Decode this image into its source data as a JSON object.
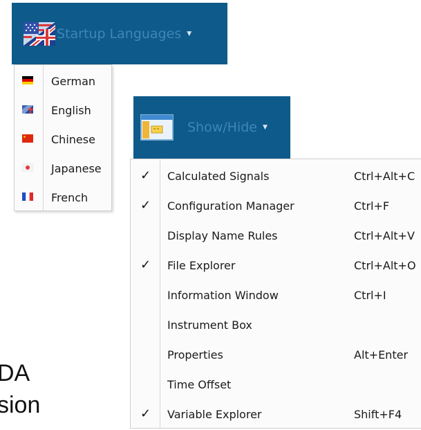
{
  "background": {
    "line1": "DA",
    "line2": "sion"
  },
  "startup_languages": {
    "label": "Startup Languages",
    "items": [
      {
        "label": "German",
        "icon": "flag-germany-icon"
      },
      {
        "label": "English",
        "icon": "flag-uk-icon"
      },
      {
        "label": "Chinese",
        "icon": "flag-china-icon"
      },
      {
        "label": "Japanese",
        "icon": "flag-japan-icon"
      },
      {
        "label": "French",
        "icon": "flag-france-icon"
      }
    ]
  },
  "show_hide": {
    "label": "Show/Hide",
    "items": [
      {
        "label": "Calculated Signals",
        "shortcut": "Ctrl+Alt+C",
        "checked": true
      },
      {
        "label": "Configuration Manager",
        "shortcut": "Ctrl+F",
        "checked": true
      },
      {
        "label": "Display Name Rules",
        "shortcut": "Ctrl+Alt+V",
        "checked": false
      },
      {
        "label": "File Explorer",
        "shortcut": "Ctrl+Alt+O",
        "checked": true
      },
      {
        "label": "Information Window",
        "shortcut": "Ctrl+I",
        "checked": false
      },
      {
        "label": "Instrument Box",
        "shortcut": "",
        "checked": false
      },
      {
        "label": "Properties",
        "shortcut": "Alt+Enter",
        "checked": false
      },
      {
        "label": "Time Offset",
        "shortcut": "",
        "checked": false
      },
      {
        "label": "Variable Explorer",
        "shortcut": "Shift+F4",
        "checked": true
      }
    ],
    "check_glyph": "✓"
  },
  "colors": {
    "ribbon": "#0e5a8a",
    "ribbon_text": "#3e86b8"
  }
}
